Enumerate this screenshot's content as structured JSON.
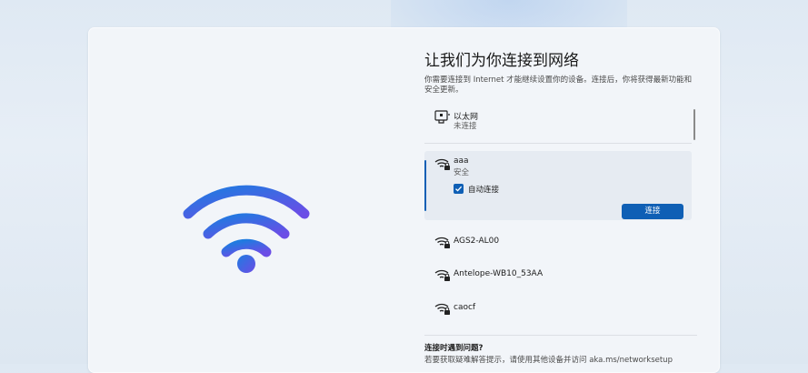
{
  "page": {
    "title": "让我们为你连接到网络",
    "subtitle": "你需要连接到 Internet 才能继续设置你的设备。连接后，你将获得最新功能和安全更新。"
  },
  "hero": {
    "icon": "wifi-icon",
    "colors": {
      "start": "#1f7be0",
      "end": "#6b4de6"
    }
  },
  "networks": {
    "ethernet": {
      "name": "以太网",
      "status": "未连接",
      "icon": "ethernet-icon"
    },
    "selected": {
      "name": "aaa",
      "status": "安全",
      "icon": "wifi-secure-icon",
      "auto_connect_label": "自动连接",
      "auto_connect_checked": true,
      "connect_label": "连接"
    },
    "items": [
      {
        "name": "AGS2-AL00",
        "icon": "wifi-secure-icon"
      },
      {
        "name": "Antelope-WB10_53AA",
        "icon": "wifi-secure-icon"
      },
      {
        "name": "caocf",
        "icon": "wifi-secure-icon"
      }
    ]
  },
  "help": {
    "title": "连接时遇到问题?",
    "text": "若要获取疑难解答提示，请使用其他设备并访问 aka.ms/networksetup"
  },
  "colors": {
    "accent": "#0f5fb5"
  }
}
